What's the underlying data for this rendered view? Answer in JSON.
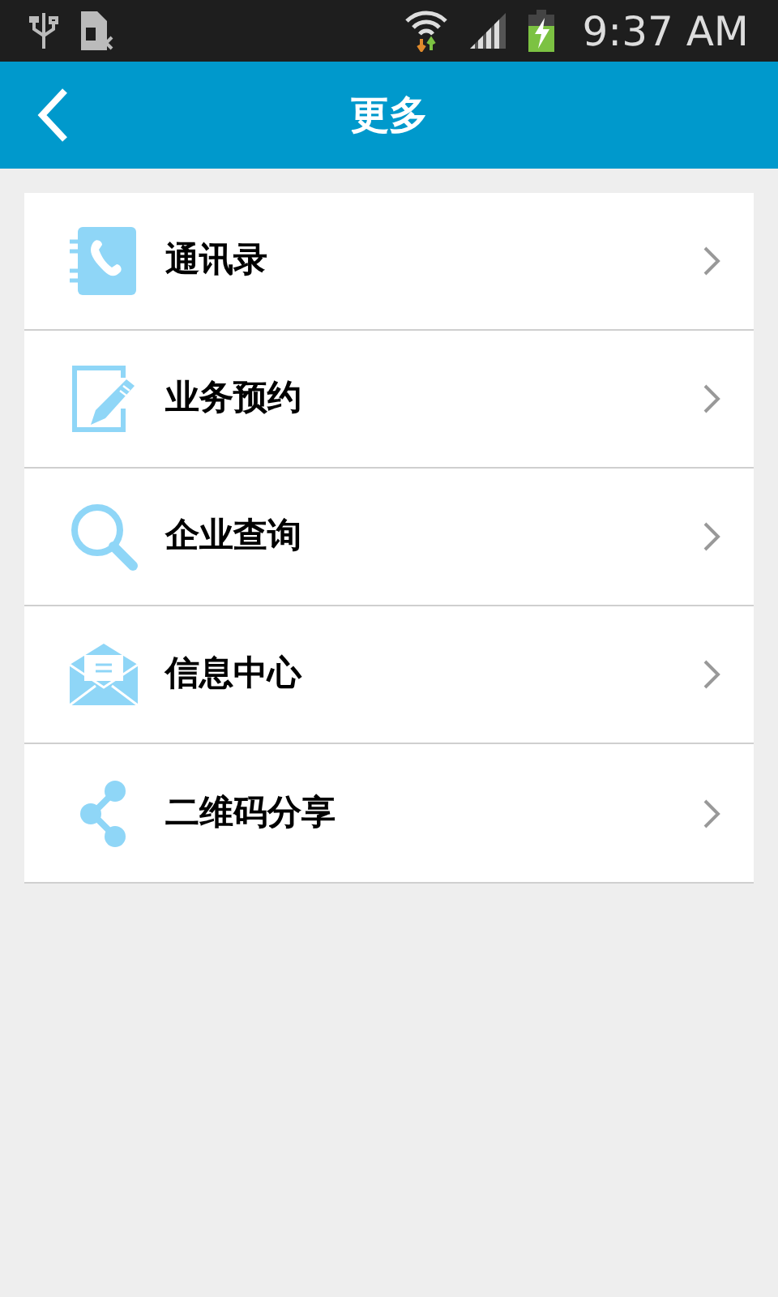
{
  "status_bar": {
    "time": "9:37 AM"
  },
  "header": {
    "title": "更多"
  },
  "menu": [
    {
      "kind": "contacts",
      "label": "通讯录"
    },
    {
      "kind": "booking",
      "label": "业务预约"
    },
    {
      "kind": "search",
      "label": "企业查询"
    },
    {
      "kind": "messages",
      "label": "信息中心"
    },
    {
      "kind": "share",
      "label": "二维码分享"
    }
  ]
}
